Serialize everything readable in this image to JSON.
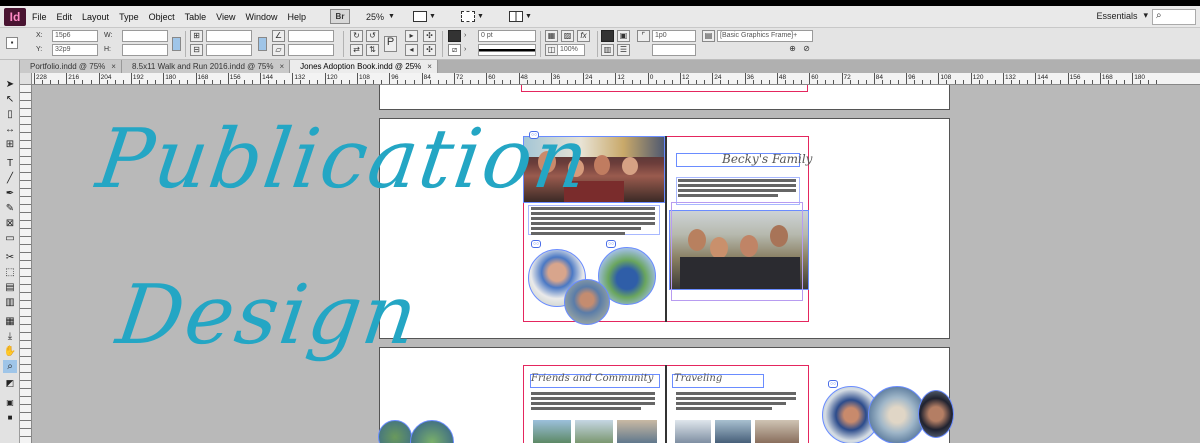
{
  "app": {
    "logo": "Id",
    "menus": [
      "File",
      "Edit",
      "Layout",
      "Type",
      "Object",
      "Table",
      "View",
      "Window",
      "Help"
    ],
    "bridge_label": "Br",
    "zoom_level": "25%",
    "workspace": "Essentials",
    "workspace_caret": "▾",
    "search_icon": "⌕"
  },
  "control_panel": {
    "x_label": "X:",
    "x_value": "15p6",
    "y_label": "Y:",
    "y_value": "32p9",
    "w_label": "W:",
    "h_label": "H:",
    "stroke_weight": "0 pt",
    "opacity": "100%",
    "ref_value": "1p0",
    "object_style": "[Basic Graphics Frame]+"
  },
  "tabs": [
    {
      "label": "Portfolio.indd @ 75%",
      "close": "×"
    },
    {
      "label": "8.5x11 Walk and Run 2016.indd @ 75%",
      "close": "×"
    },
    {
      "label": "Jones Adoption Book.indd @ 25%",
      "close": "×"
    }
  ],
  "ruler_labels": [
    "228",
    "216",
    "204",
    "192",
    "180",
    "168",
    "156",
    "144",
    "132",
    "120",
    "108",
    "96",
    "84",
    "72",
    "60",
    "48",
    "36",
    "24",
    "12",
    "0",
    "12",
    "24",
    "36",
    "48",
    "60",
    "72",
    "84",
    "96",
    "108",
    "120",
    "132",
    "144",
    "156",
    "168",
    "180"
  ],
  "overlay": {
    "line1": "Publication",
    "line2": "Design",
    "color": "#24a6c4"
  },
  "document": {
    "spread1_title": "Becky's Family",
    "spread2_left_title": "Friends and Community",
    "spread2_right_title": "Traveling",
    "accent_red": "#e4265e",
    "frame_blue": "#6a8cff"
  }
}
